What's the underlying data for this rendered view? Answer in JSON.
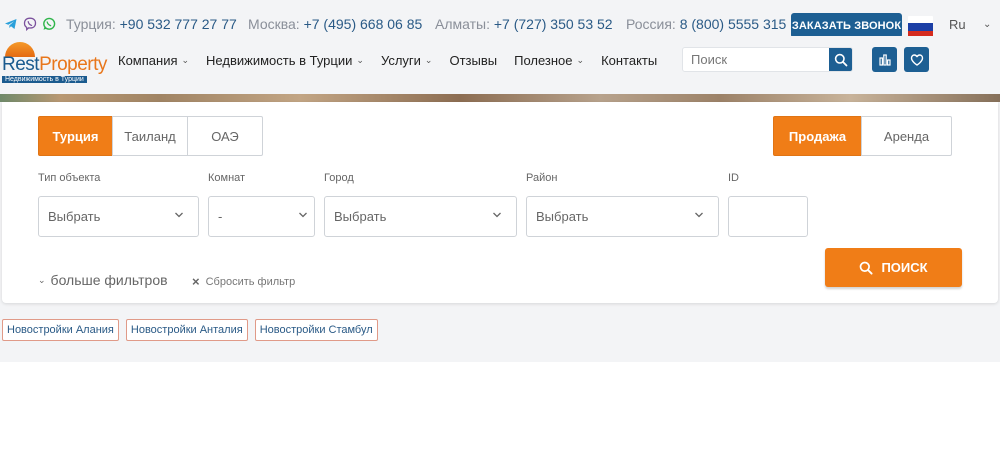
{
  "topbar": {
    "messengers": [
      {
        "name": "telegram-icon",
        "color": "#2aa0da"
      },
      {
        "name": "viber-icon",
        "color": "#7b519d"
      },
      {
        "name": "whatsapp-icon",
        "color": "#30b54b"
      }
    ],
    "phones": [
      {
        "label": "Турция:",
        "number": "+90 532 777 27 77"
      },
      {
        "label": "Москва:",
        "number": "+7 (495) 668 06 85"
      },
      {
        "label": "Алматы:",
        "number": "+7 (727) 350 53 52"
      },
      {
        "label": "Россия:",
        "number": "8 (800) 5555 315"
      }
    ],
    "call_button": "ЗАКАЗАТЬ ЗВОНОК",
    "language": "Ru"
  },
  "logo": {
    "part1": "Rest",
    "part2": "Property",
    "subtitle": "Недвижимость в Турции"
  },
  "nav": {
    "items": [
      {
        "label": "Компания",
        "dropdown": true
      },
      {
        "label": "Недвижимость в Турции",
        "dropdown": true
      },
      {
        "label": "Услуги",
        "dropdown": true
      },
      {
        "label": "Отзывы",
        "dropdown": false
      },
      {
        "label": "Полезное",
        "dropdown": true
      },
      {
        "label": "Контакты",
        "dropdown": false
      }
    ],
    "search_placeholder": "Поиск"
  },
  "filter": {
    "country_tabs": [
      {
        "label": "Турция",
        "active": true
      },
      {
        "label": "Таиланд",
        "active": false
      },
      {
        "label": "ОАЭ",
        "active": false
      }
    ],
    "deal_tabs": [
      {
        "label": "Продажа",
        "active": true
      },
      {
        "label": "Аренда",
        "active": false
      }
    ],
    "fields": [
      {
        "label": "Тип объекта",
        "value": "Выбрать"
      },
      {
        "label": "Комнат",
        "value": "-"
      },
      {
        "label": "Город",
        "value": "Выбрать"
      },
      {
        "label": "Район",
        "value": "Выбрать"
      },
      {
        "label": "ID",
        "value": ""
      }
    ],
    "more_filters": "больше фильтров",
    "reset_filter": "Сбросить фильтр",
    "search_button": "ПОИСК"
  },
  "chips": [
    "Новостройки Алания",
    "Новостройки Анталия",
    "Новостройки Стамбул"
  ],
  "colors": {
    "brand_blue": "#1d5f93",
    "accent_orange": "#f07d17"
  }
}
